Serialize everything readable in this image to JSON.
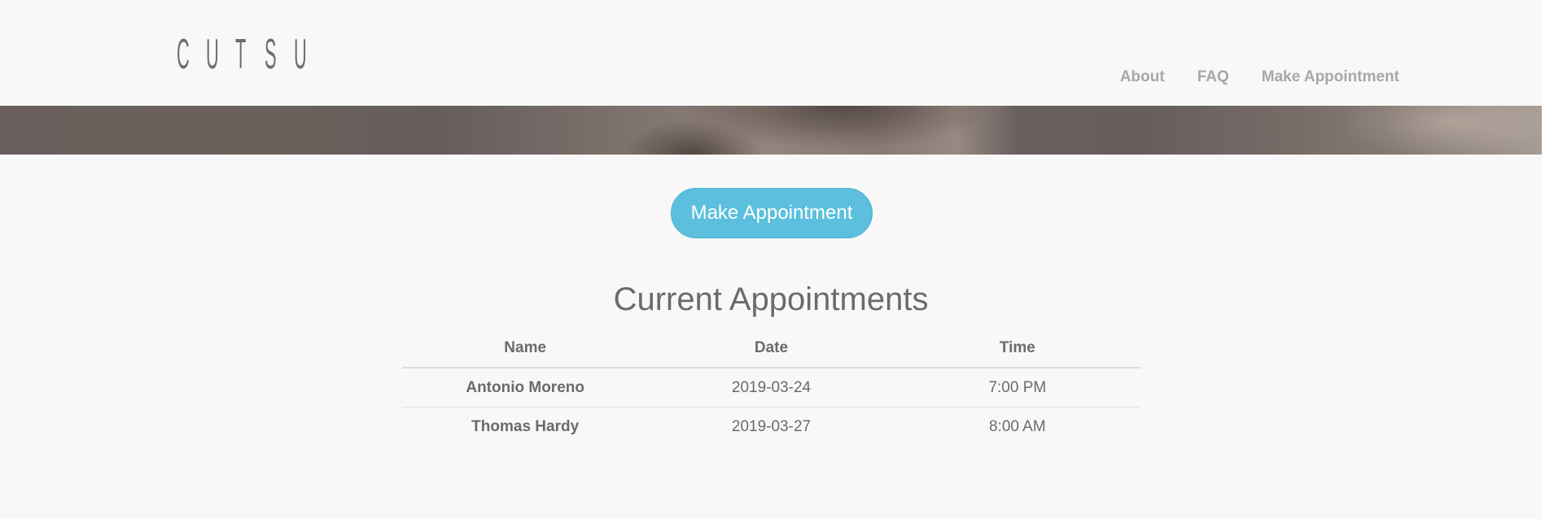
{
  "brand": {
    "logo_letters": [
      "C",
      "U",
      "T",
      "S",
      "U"
    ]
  },
  "nav": {
    "items": [
      {
        "label": "About"
      },
      {
        "label": "FAQ"
      },
      {
        "label": "Make Appointment"
      }
    ]
  },
  "hero": {
    "image": "barber-photo-banner"
  },
  "main": {
    "cta_label": "Make Appointment",
    "title": "Current Appointments",
    "table": {
      "headers": [
        "Name",
        "Date",
        "Time"
      ],
      "rows": [
        {
          "name": "Antonio Moreno",
          "date": "2019-03-24",
          "time": "7:00 PM"
        },
        {
          "name": "Thomas Hardy",
          "date": "2019-03-27",
          "time": "8:00 AM"
        }
      ]
    }
  },
  "colors": {
    "accent": "#5bbfdd",
    "text": "#6b6b6b",
    "nav_text": "#a7a7a7",
    "background": "#f9f8f8"
  }
}
